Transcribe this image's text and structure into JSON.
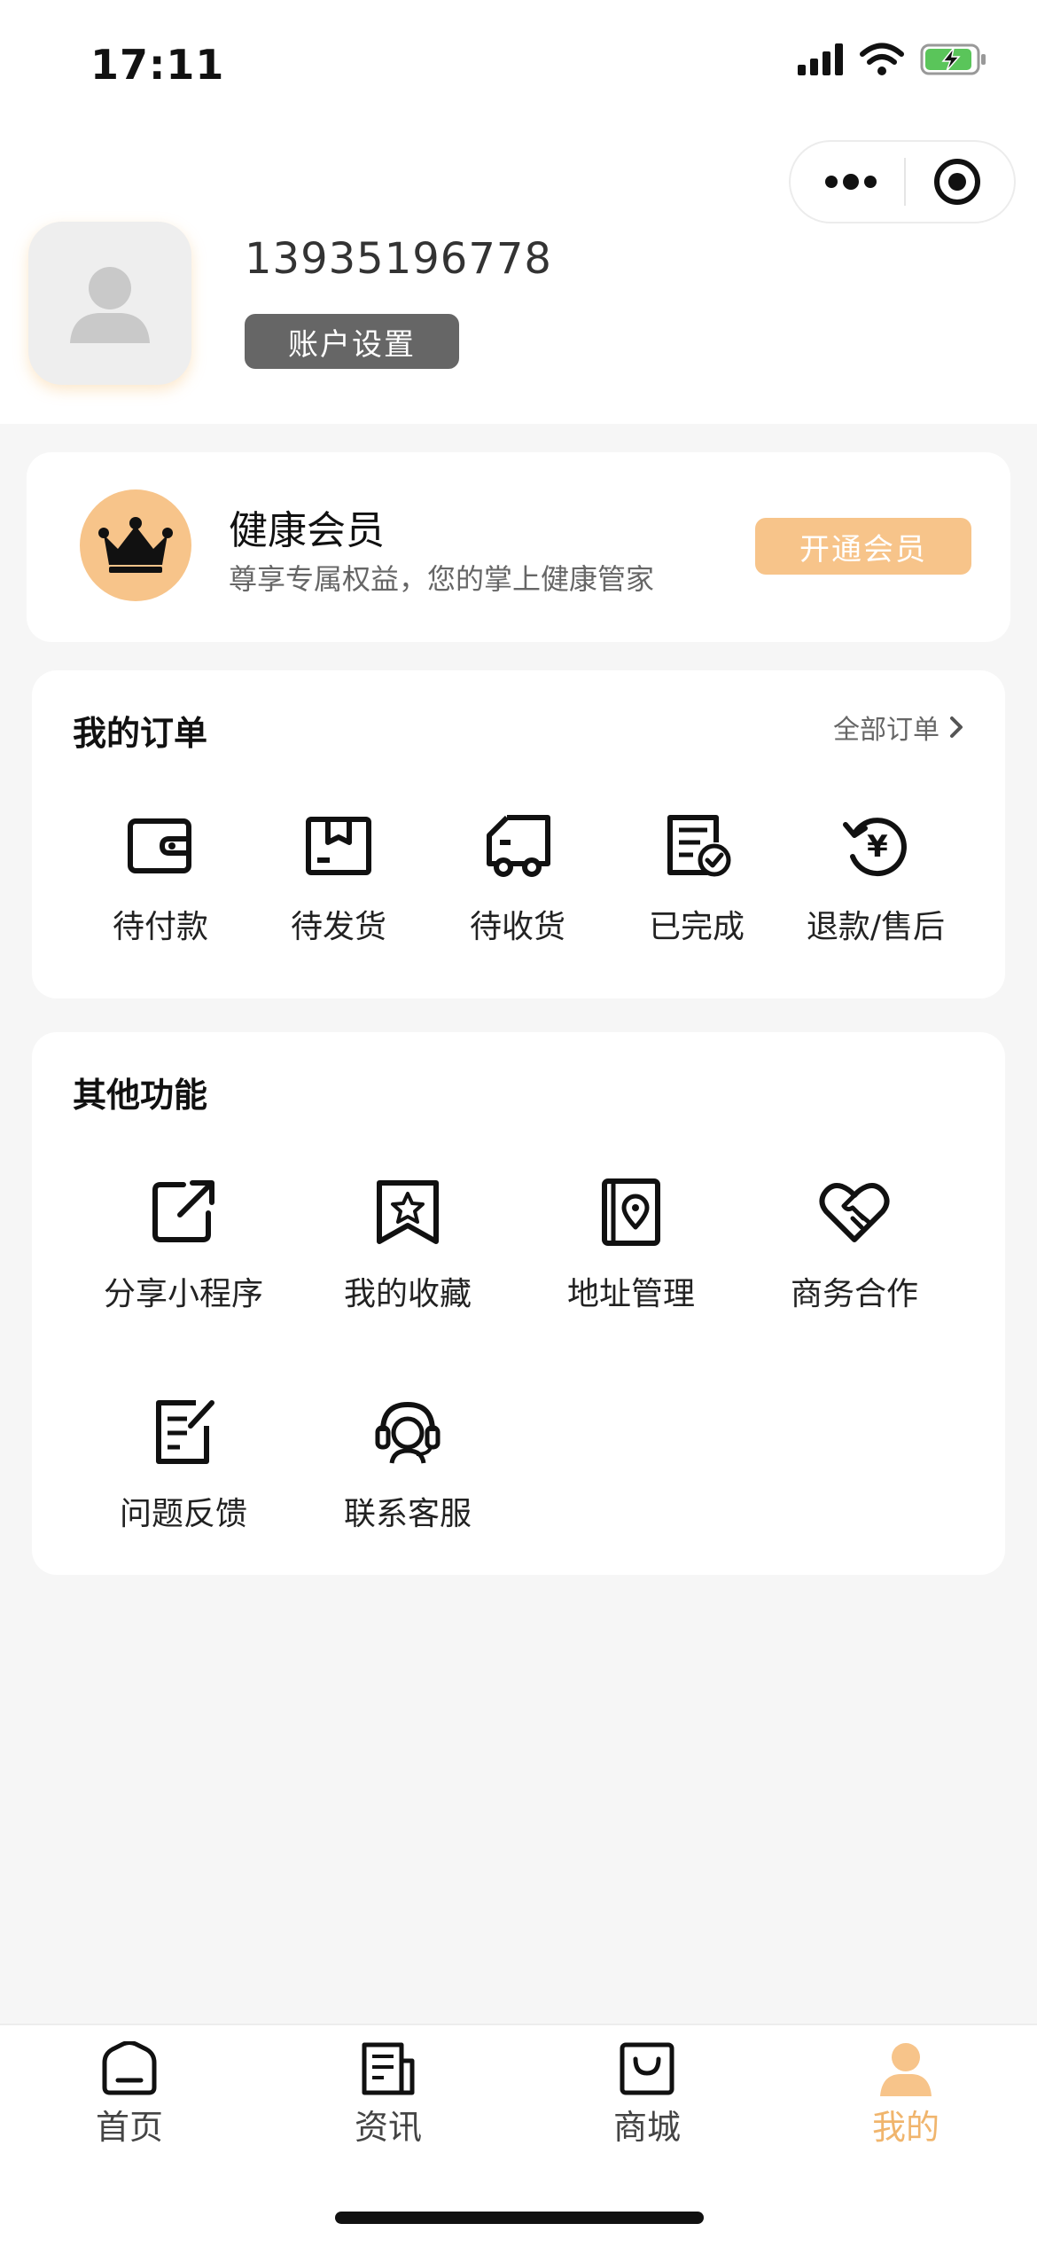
{
  "status": {
    "time": "17:11"
  },
  "profile": {
    "phone": "13935196778",
    "settings_label": "账户设置"
  },
  "member": {
    "title": "健康会员",
    "subtitle": "尊享专属权益，您的掌上健康管家",
    "button": "开通会员",
    "accent": "#f7c48a"
  },
  "orders": {
    "title": "我的订单",
    "all_label": "全部订单",
    "items": [
      {
        "label": "待付款",
        "icon": "wallet-icon"
      },
      {
        "label": "待发货",
        "icon": "package-icon"
      },
      {
        "label": "待收货",
        "icon": "truck-icon"
      },
      {
        "label": "已完成",
        "icon": "completed-doc-icon"
      },
      {
        "label": "退款/售后",
        "icon": "refund-icon"
      }
    ]
  },
  "functions": {
    "title": "其他功能",
    "items": [
      {
        "label": "分享小程序",
        "icon": "share-icon"
      },
      {
        "label": "我的收藏",
        "icon": "favorite-icon"
      },
      {
        "label": "地址管理",
        "icon": "address-icon"
      },
      {
        "label": "商务合作",
        "icon": "handshake-icon"
      },
      {
        "label": "问题反馈",
        "icon": "feedback-icon"
      },
      {
        "label": "联系客服",
        "icon": "customer-service-icon"
      }
    ]
  },
  "tabbar": {
    "items": [
      {
        "label": "首页",
        "icon": "home-icon"
      },
      {
        "label": "资讯",
        "icon": "news-icon"
      },
      {
        "label": "商城",
        "icon": "shop-bag-icon"
      },
      {
        "label": "我的",
        "icon": "profile-icon",
        "active": true
      }
    ],
    "active_color": "#f0b56d"
  }
}
